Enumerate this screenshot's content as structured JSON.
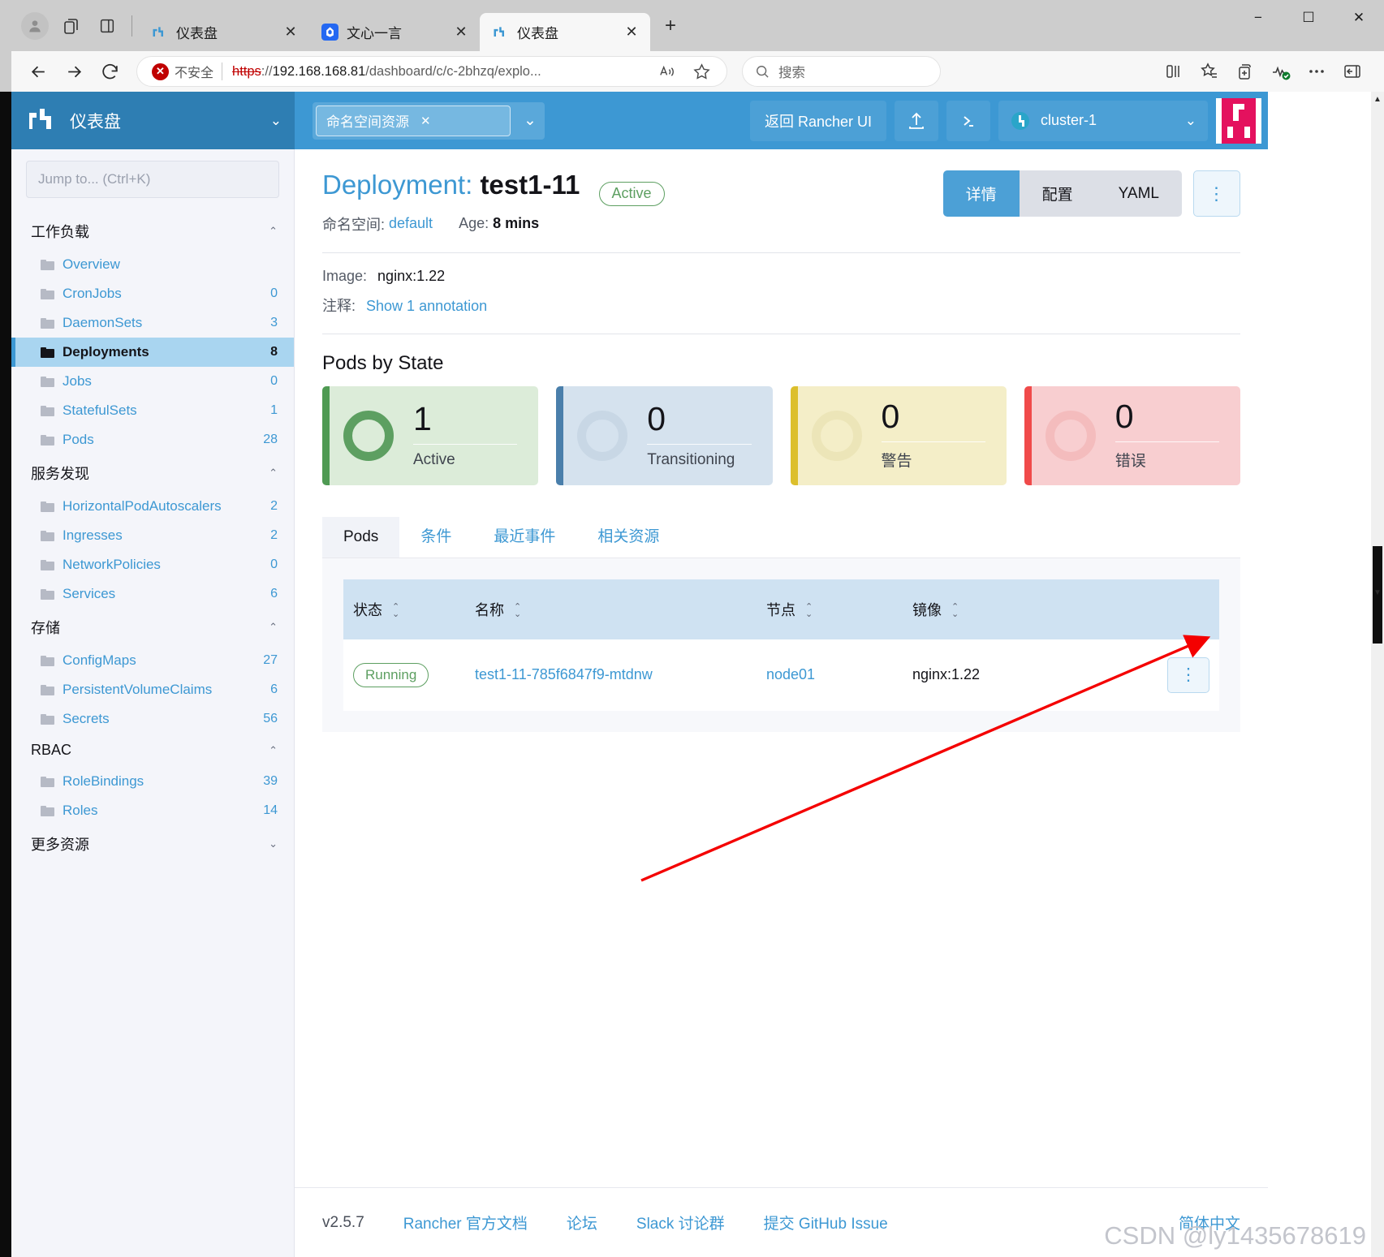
{
  "browser": {
    "tabs": [
      {
        "title": "仪表盘",
        "favicon": "rancher-icon",
        "active": false
      },
      {
        "title": "文心一言",
        "favicon": "wenxin-icon",
        "active": false
      },
      {
        "title": "仪表盘",
        "favicon": "rancher-icon",
        "active": true
      }
    ],
    "new_tab_label": "+",
    "window_controls": {
      "minimize": "−",
      "maximize": "☐",
      "close": "✕"
    },
    "address": {
      "security_label": "不安全",
      "protocol": "https",
      "rest": "://192.168.168.81/dashboard/c/c-2bhzq/explo...",
      "host_part": "192.168.168.81",
      "path_part": "/dashboard/c/c-2bhzq/explo..."
    },
    "search_placeholder": "搜索"
  },
  "header": {
    "brand_title": "仪表盘",
    "namespace_filter": "命名空间资源",
    "back_to_rancher": "返回 Rancher UI",
    "cluster_name": "cluster-1"
  },
  "sidebar": {
    "jump_placeholder": "Jump to... (Ctrl+K)",
    "groups": [
      {
        "label": "工作负载",
        "expanded": true,
        "items": [
          {
            "label": "Overview",
            "count": ""
          },
          {
            "label": "CronJobs",
            "count": "0"
          },
          {
            "label": "DaemonSets",
            "count": "3"
          },
          {
            "label": "Deployments",
            "count": "8",
            "active": true
          },
          {
            "label": "Jobs",
            "count": "0"
          },
          {
            "label": "StatefulSets",
            "count": "1"
          },
          {
            "label": "Pods",
            "count": "28"
          }
        ]
      },
      {
        "label": "服务发现",
        "expanded": true,
        "items": [
          {
            "label": "HorizontalPodAutoscalers",
            "count": "2"
          },
          {
            "label": "Ingresses",
            "count": "2"
          },
          {
            "label": "NetworkPolicies",
            "count": "0"
          },
          {
            "label": "Services",
            "count": "6"
          }
        ]
      },
      {
        "label": "存储",
        "expanded": true,
        "items": [
          {
            "label": "ConfigMaps",
            "count": "27"
          },
          {
            "label": "PersistentVolumeClaims",
            "count": "6"
          },
          {
            "label": "Secrets",
            "count": "56"
          }
        ]
      },
      {
        "label": "RBAC",
        "expanded": true,
        "items": [
          {
            "label": "RoleBindings",
            "count": "39"
          },
          {
            "label": "Roles",
            "count": "14"
          }
        ]
      },
      {
        "label": "更多资源",
        "expanded": false,
        "items": []
      }
    ]
  },
  "main": {
    "title_prefix": "Deployment:",
    "resource_name": "test1-11",
    "status": "Active",
    "namespace_label": "命名空间:",
    "namespace_value": "default",
    "age_label": "Age:",
    "age_value": "8 mins",
    "image_label": "Image:",
    "image_value": "nginx:1.22",
    "annotations_label": "注释:",
    "annotations_link": "Show 1 annotation",
    "view_tabs": [
      {
        "label": "详情",
        "active": true
      },
      {
        "label": "配置",
        "active": false
      },
      {
        "label": "YAML",
        "active": false
      }
    ],
    "section_title": "Pods by State",
    "state_cards": [
      {
        "value": "1",
        "label": "Active",
        "bar": "#4f9a53",
        "bg": "#dcecd9",
        "ring": "#5d9f61"
      },
      {
        "value": "0",
        "label": "Transitioning",
        "bar": "#4a7fab",
        "bg": "#d5e2ee",
        "ring": "#c8d7e5"
      },
      {
        "value": "0",
        "label": "警告",
        "bar": "#dcbf2c",
        "bg": "#f4eec8",
        "ring": "#ece5b8"
      },
      {
        "value": "0",
        "label": "错误",
        "bar": "#f04a4a",
        "bg": "#f8ced0",
        "ring": "#f4bcbd"
      }
    ],
    "panel_tabs": [
      {
        "label": "Pods",
        "active": true
      },
      {
        "label": "条件",
        "active": false
      },
      {
        "label": "最近事件",
        "active": false
      },
      {
        "label": "相关资源",
        "active": false
      }
    ],
    "table": {
      "columns": [
        "状态",
        "名称",
        "节点",
        "镜像",
        ""
      ],
      "rows": [
        {
          "status": "Running",
          "name": "test1-11-785f6847f9-mtdnw",
          "node": "node01",
          "image": "nginx:1.22",
          "actions": "⋮"
        }
      ]
    }
  },
  "footer": {
    "version": "v2.5.7",
    "links": [
      "Rancher 官方文档",
      "论坛",
      "Slack 讨论群",
      "提交 GitHub Issue"
    ],
    "language": "简体中文"
  },
  "annotation": {
    "watermark": "CSDN @ly1435678619",
    "arrow_color": "#f40000"
  }
}
